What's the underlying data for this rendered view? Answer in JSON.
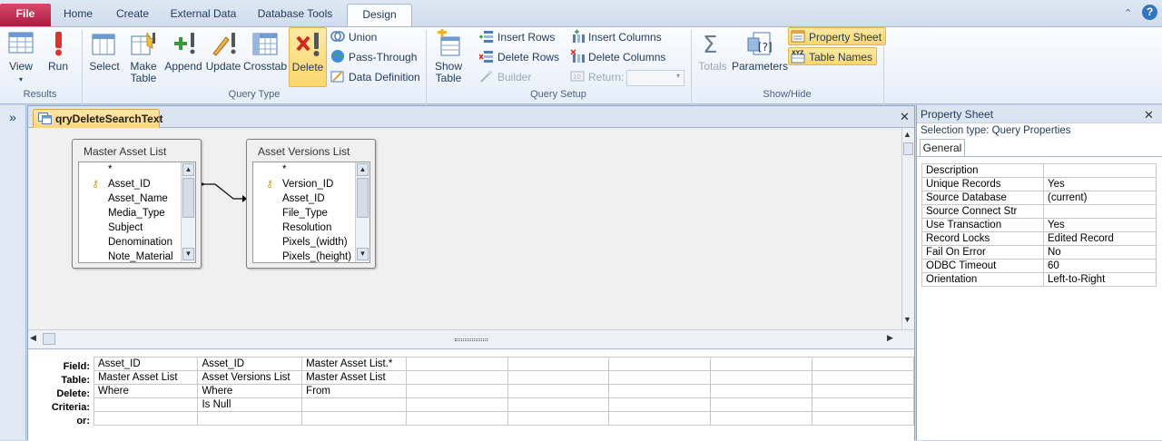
{
  "ribbon_tabs": [
    "File",
    "Home",
    "Create",
    "External Data",
    "Database Tools",
    "Design"
  ],
  "groups": {
    "results": {
      "label": "Results",
      "view": "View",
      "run": "Run"
    },
    "query_type": {
      "label": "Query Type",
      "select": "Select",
      "make_table": "Make Table",
      "append": "Append",
      "update": "Update",
      "crosstab": "Crosstab",
      "delete": "Delete",
      "union": "Union",
      "pass_through": "Pass-Through",
      "data_definition": "Data Definition"
    },
    "query_setup": {
      "label": "Query Setup",
      "show_table": "Show Table",
      "insert_rows": "Insert Rows",
      "delete_rows": "Delete Rows",
      "builder": "Builder",
      "insert_columns": "Insert Columns",
      "delete_columns": "Delete Columns",
      "return": "Return:"
    },
    "show_hide": {
      "label": "Show/Hide",
      "totals": "Totals",
      "parameters": "Parameters",
      "property_sheet": "Property Sheet",
      "table_names": "Table Names"
    }
  },
  "nav_toggle": "»",
  "document_tab": "qryDeleteSearchText",
  "tables": [
    {
      "title": "Master Asset List",
      "fields": [
        "*",
        "Asset_ID",
        "Asset_Name",
        "Media_Type",
        "Subject",
        "Denomination",
        "Note_Material"
      ],
      "key_field": 1
    },
    {
      "title": "Asset Versions List",
      "fields": [
        "*",
        "Version_ID",
        "Asset_ID",
        "File_Type",
        "Resolution",
        "Pixels_(width)",
        "Pixels_(height)"
      ],
      "key_field": 1
    }
  ],
  "grid": {
    "row_labels": [
      "Field:",
      "Table:",
      "Delete:",
      "Criteria:",
      "or:"
    ],
    "columns": [
      [
        "Asset_ID",
        "Master Asset List",
        "Where",
        "",
        ""
      ],
      [
        "Asset_ID",
        "Asset Versions List",
        "Where",
        "Is Null",
        ""
      ],
      [
        "Master Asset List.*",
        "Master Asset List",
        "From",
        "",
        ""
      ],
      [
        "",
        "",
        "",
        "",
        ""
      ],
      [
        "",
        "",
        "",
        "",
        ""
      ],
      [
        "",
        "",
        "",
        "",
        ""
      ],
      [
        "",
        "",
        "",
        "",
        ""
      ],
      [
        "",
        "",
        "",
        "",
        ""
      ]
    ]
  },
  "property_sheet": {
    "title": "Property Sheet",
    "selection_type": "Selection type:  Query Properties",
    "tab": "General",
    "rows": [
      [
        "Description",
        ""
      ],
      [
        "Unique Records",
        "Yes"
      ],
      [
        "Source Database",
        "(current)"
      ],
      [
        "Source Connect Str",
        ""
      ],
      [
        "Use Transaction",
        "Yes"
      ],
      [
        "Record Locks",
        "Edited Record"
      ],
      [
        "Fail On Error",
        "No"
      ],
      [
        "ODBC Timeout",
        "60"
      ],
      [
        "Orientation",
        "Left-to-Right"
      ]
    ]
  },
  "colors": {
    "file_tab": "#c0284a",
    "highlight": "#fcd66b",
    "doc_tab": "#f9d679"
  }
}
